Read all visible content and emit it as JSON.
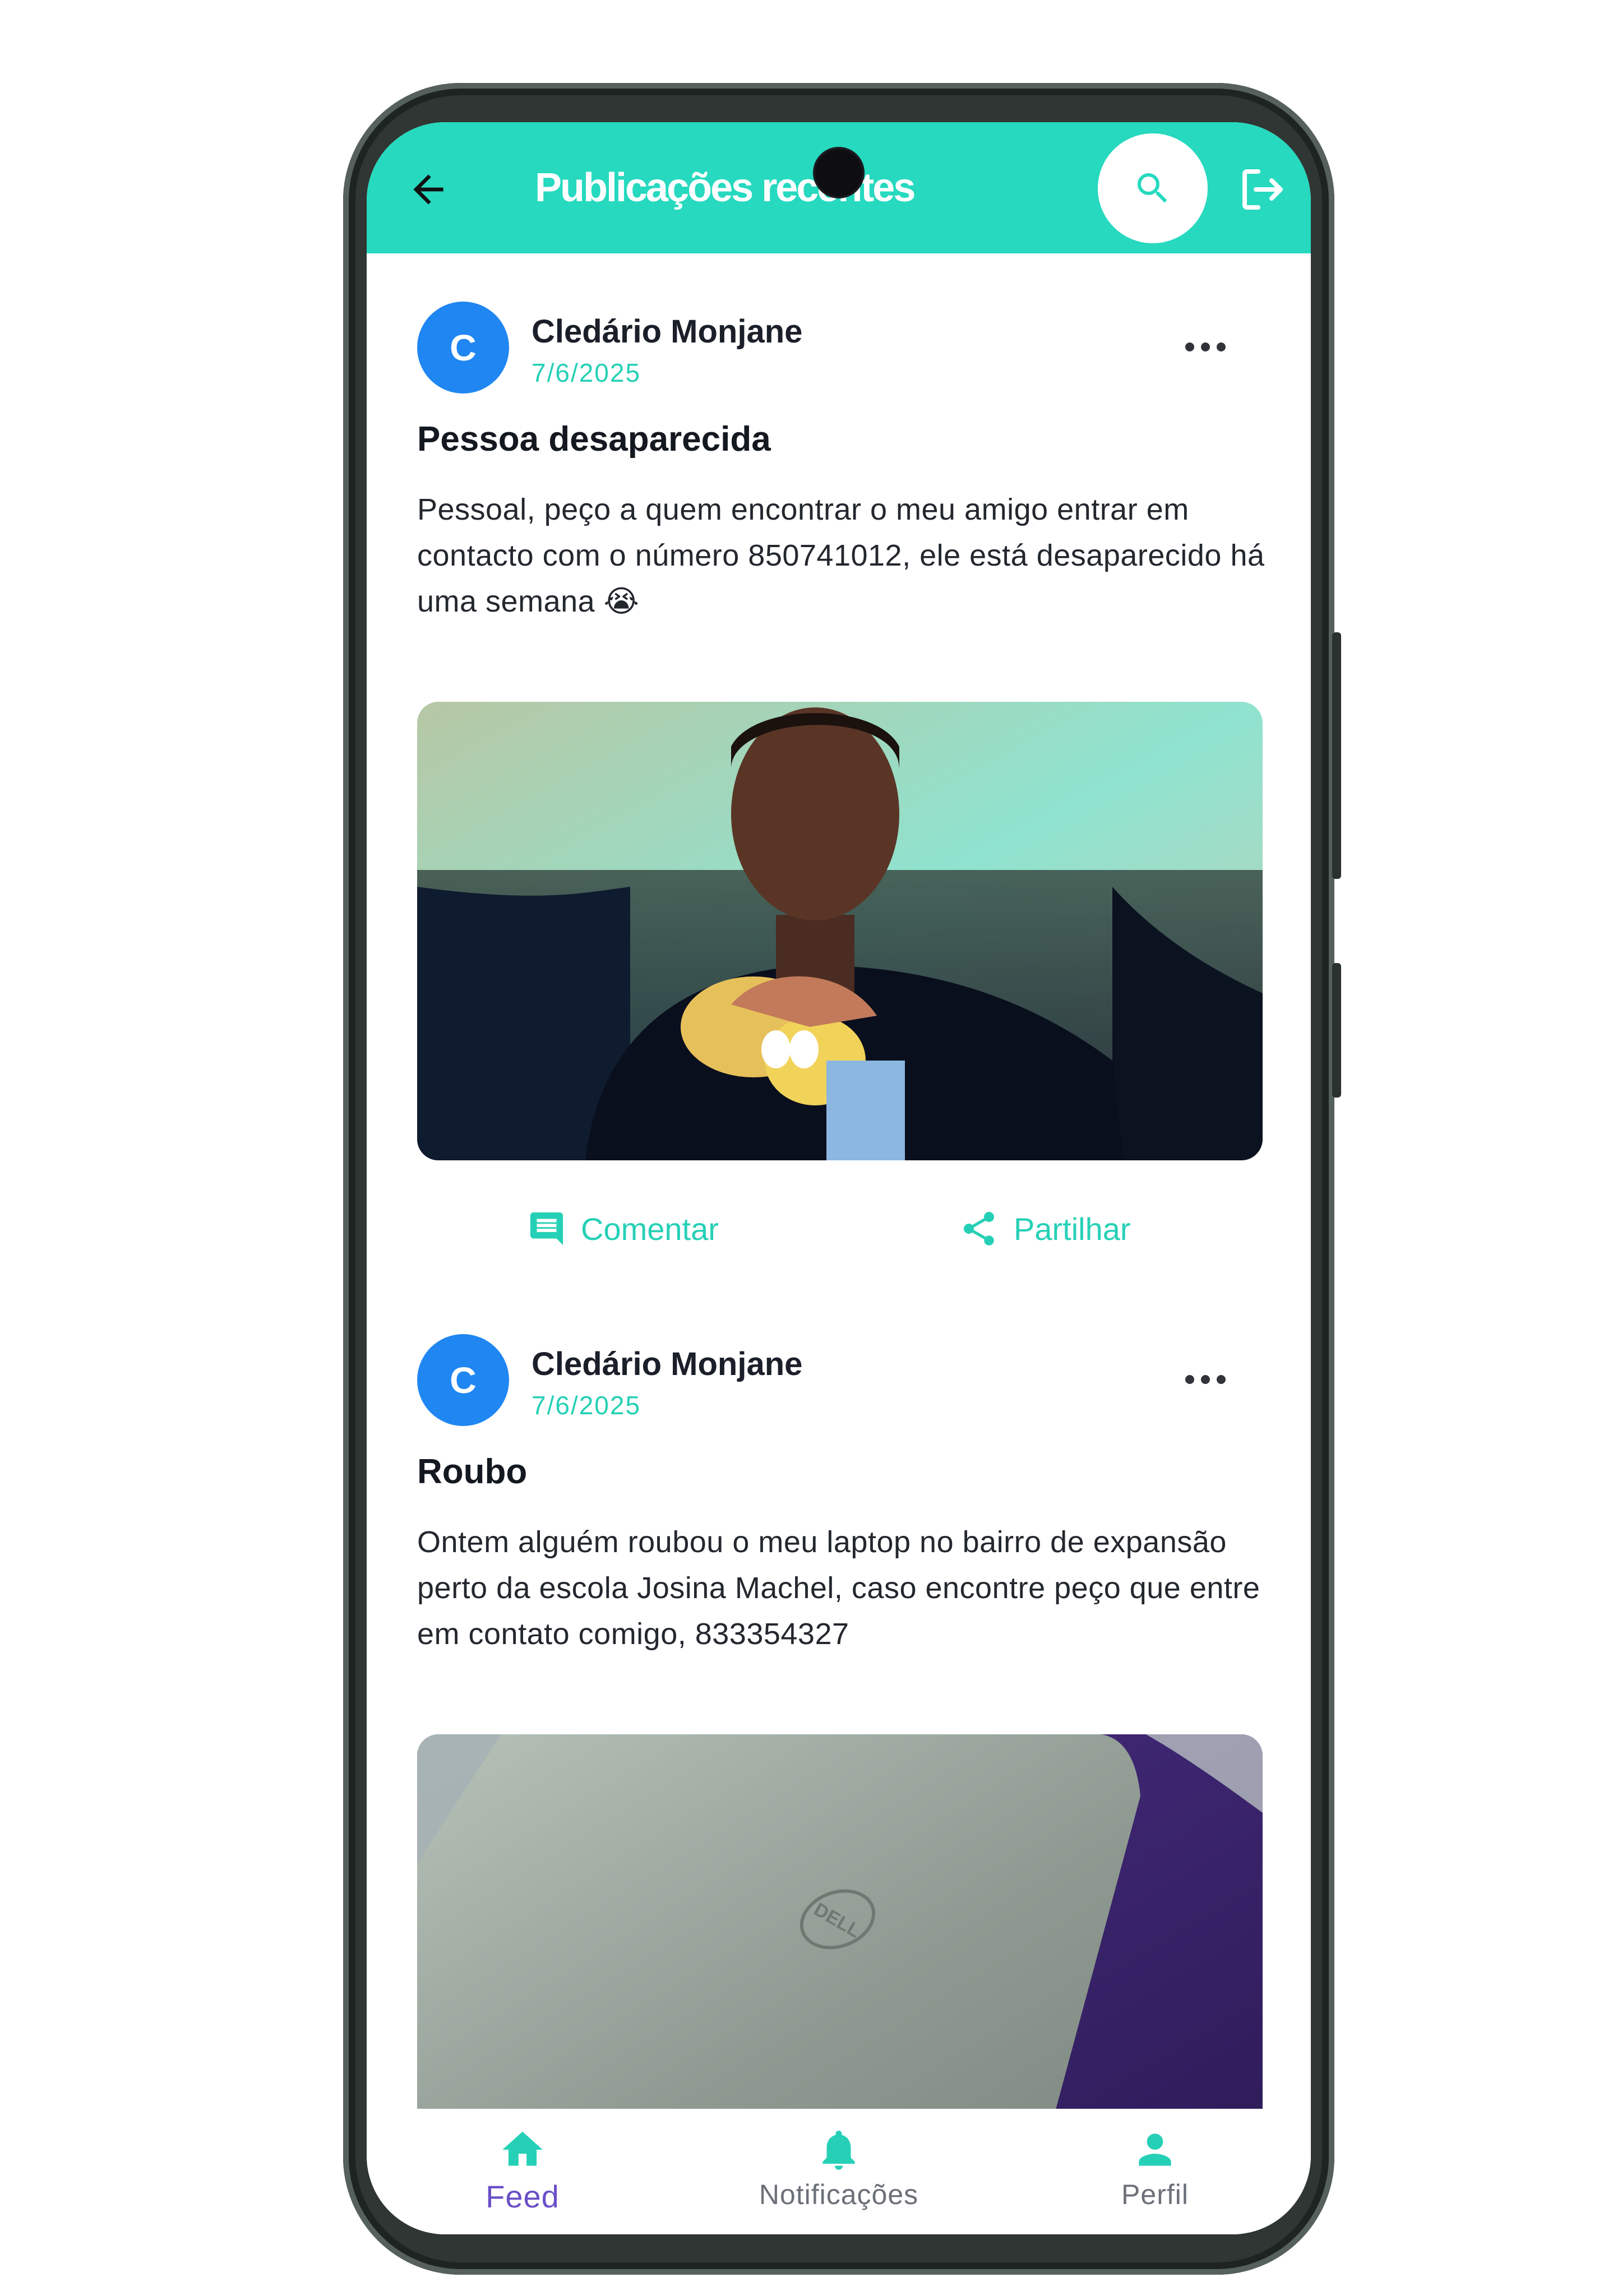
{
  "header": {
    "title": "Publicações recentes",
    "color": "#26d9bf"
  },
  "posts": [
    {
      "avatar_letter": "C",
      "author": "Cledário Monjane",
      "date": "7/6/2025",
      "title": "Pessoa desaparecida",
      "body": "Pessoal, peço a quem encontrar o meu amigo entrar em contacto com o número 850741012, ele está desaparecido há uma semana 😭",
      "comment_label": "Comentar",
      "share_label": "Partilhar"
    },
    {
      "avatar_letter": "C",
      "author": "Cledário Monjane",
      "date": "7/6/2025",
      "title": "Roubo",
      "body": "Ontem alguém roubou o meu laptop  no bairro de expansão perto da escola Josina Machel, caso encontre peço que entre em contato comigo, 833354327"
    }
  ],
  "bottom_nav": {
    "items": [
      {
        "label": "Feed",
        "icon": "home-icon",
        "active": true
      },
      {
        "label": "Notificações",
        "icon": "bell-icon"
      },
      {
        "label": "Perfil",
        "icon": "person-icon"
      }
    ]
  },
  "colors": {
    "accent": "#26d9bf",
    "avatar": "#1f86f2",
    "nav_active": "#6a4fc8"
  }
}
